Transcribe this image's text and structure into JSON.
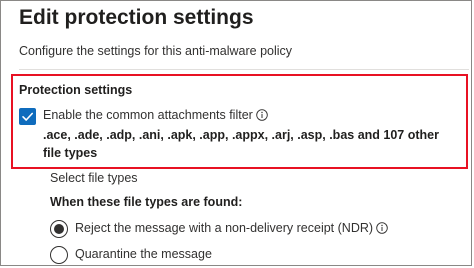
{
  "page": {
    "title": "Edit protection settings",
    "description": "Configure the settings for this anti-malware policy"
  },
  "protection_settings": {
    "heading": "Protection settings",
    "common_attachments_filter": {
      "label": "Enable the common attachments filter",
      "checked": true,
      "file_types": ".ace, .ade, .adp, .ani, .apk, .app, .appx, .arj, .asp, .bas and 107 other file types"
    },
    "select_file_types_label": "Select file types",
    "when_found": {
      "label": "When these file types are found:",
      "options": [
        {
          "label": "Reject the message with a non-delivery receipt (NDR)",
          "selected": true
        },
        {
          "label": "Quarantine the message",
          "selected": false
        }
      ]
    }
  },
  "colors": {
    "accent": "#0f6cbd",
    "highlight": "#e81123",
    "text": "#323130"
  },
  "icons": {
    "checkbox": "checkmark-icon",
    "info": "info-icon"
  }
}
